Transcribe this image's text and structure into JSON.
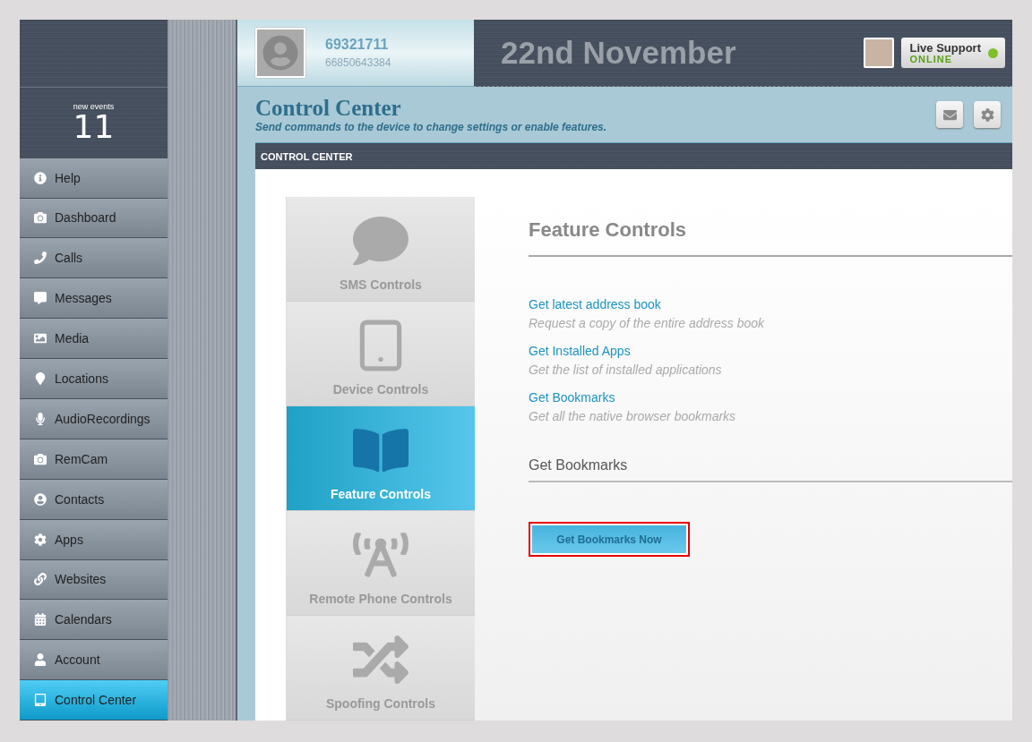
{
  "sidebar": {
    "events": {
      "label": "new events",
      "count": "11"
    },
    "items": [
      {
        "label": "Help",
        "selected": false
      },
      {
        "label": "Dashboard",
        "selected": false
      },
      {
        "label": "Calls",
        "selected": false
      },
      {
        "label": "Messages",
        "selected": false
      },
      {
        "label": "Media",
        "selected": false
      },
      {
        "label": "Locations",
        "selected": false
      },
      {
        "label": "AudioRecordings",
        "selected": false
      },
      {
        "label": "RemCam",
        "selected": false
      },
      {
        "label": "Contacts",
        "selected": false
      },
      {
        "label": "Apps",
        "selected": false
      },
      {
        "label": "Websites",
        "selected": false
      },
      {
        "label": "Calendars",
        "selected": false
      },
      {
        "label": "Account",
        "selected": false
      },
      {
        "label": "Control Center",
        "selected": true
      }
    ]
  },
  "header": {
    "user_id": "69321711",
    "phone": "66850643384",
    "date": "22nd November",
    "support": {
      "label": "Live Support",
      "status": "ONLINE",
      "color": "#7fbf2a"
    }
  },
  "page": {
    "title": "Control Center",
    "subtitle": "Send commands to the device to change settings or enable features.",
    "section_bar": "CONTROL CENTER"
  },
  "control_tabs": [
    {
      "label": "SMS Controls",
      "selected": false
    },
    {
      "label": "Device Controls",
      "selected": false
    },
    {
      "label": "Feature Controls",
      "selected": true
    },
    {
      "label": "Remote Phone Controls",
      "selected": false
    },
    {
      "label": "Spoofing Controls",
      "selected": false
    }
  ],
  "feature_panel": {
    "title": "Feature Controls",
    "actions": [
      {
        "link": "Get latest address book",
        "description": "Request a copy of the entire address book"
      },
      {
        "link": "Get Installed Apps",
        "description": "Get the list of installed applications"
      },
      {
        "link": "Get Bookmarks",
        "description": "Get all the native browser bookmarks"
      }
    ],
    "section_title": "Get Bookmarks",
    "button": "Get Bookmarks Now"
  }
}
